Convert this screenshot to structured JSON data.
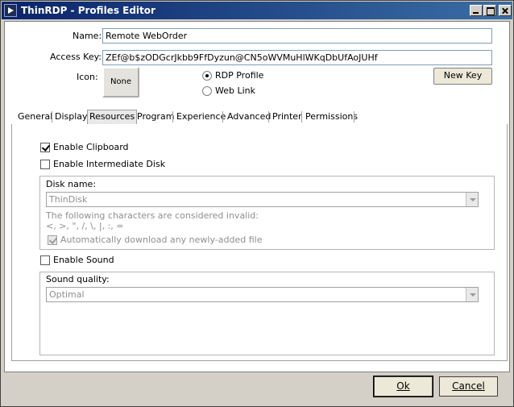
{
  "window": {
    "title": "ThinRDP - Profiles Editor"
  },
  "form": {
    "name_label": "Name:",
    "name_value": "Remote WebOrder",
    "access_key_label": "Access Key:",
    "access_key_value": "ZEf@b$zODGcrJkbb9FfDyzun@CN5oWVMuHlWKqDbUfAoJUHf",
    "icon_label": "Icon:",
    "icon_button": "None",
    "radio_rdp": "RDP Profile",
    "radio_weblink": "Web Link",
    "selected_type": "RDP Profile",
    "new_key_button": "New Key"
  },
  "tabs": [
    {
      "label": "General"
    },
    {
      "label": "Display"
    },
    {
      "label": "Resources",
      "active": true
    },
    {
      "label": "Program"
    },
    {
      "label": "Experience"
    },
    {
      "label": "Advanced"
    },
    {
      "label": "Printer"
    },
    {
      "label": "Permissions"
    }
  ],
  "resources": {
    "enable_clipboard": "Enable Clipboard",
    "enable_clipboard_checked": true,
    "enable_intermediate_disk": "Enable Intermediate Disk",
    "enable_intermediate_disk_checked": false,
    "disk_name_label": "Disk name:",
    "disk_name_value": "ThinDisk",
    "invalid_chars_note": "The following characters are considered invalid:",
    "invalid_chars": "<, >, \", /, \\, |, :, =",
    "auto_download": "Automatically download any newly-added file",
    "auto_download_checked": true,
    "enable_sound": "Enable Sound",
    "enable_sound_checked": false,
    "sound_quality_label": "Sound quality:",
    "sound_quality_value": "Optimal"
  },
  "footer": {
    "ok_button": "Ok",
    "cancel_button": "Cancel"
  }
}
